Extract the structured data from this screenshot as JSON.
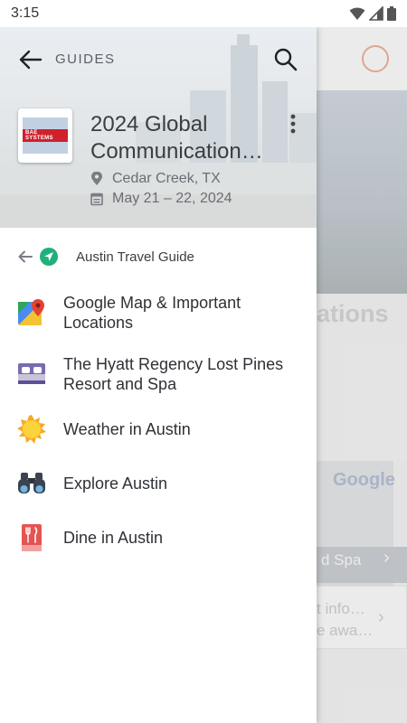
{
  "status_bar": {
    "time": "3:15"
  },
  "drawer": {
    "section_label": "GUIDES",
    "event": {
      "title_line1": "2024 Global",
      "title_line2": "Communication…",
      "logo_text": "BAE SYSTEMS",
      "location": "Cedar Creek, TX",
      "dates": "May 21 – 22, 2024"
    },
    "current_guide": "Austin Travel Guide",
    "items": [
      {
        "label": "Google Map & Important Locations",
        "icon": "map-pin-icon"
      },
      {
        "label": "The Hyatt Regency Lost Pines Resort and Spa",
        "icon": "bed-icon"
      },
      {
        "label": "Weather in Austin",
        "icon": "sun-icon"
      },
      {
        "label": "Explore Austin",
        "icon": "binoculars-icon"
      },
      {
        "label": "Dine in Austin",
        "icon": "restaurant-icon"
      }
    ]
  },
  "background": {
    "title_fragment": "ations",
    "google_text": "Google",
    "card_text": "d Spa",
    "info_line1": "t info…",
    "info_line2": "e awa…"
  },
  "colors": {
    "accent_green": "#21b07a",
    "profile_outline": "#f4b3a0",
    "text_primary": "#2e3136"
  }
}
